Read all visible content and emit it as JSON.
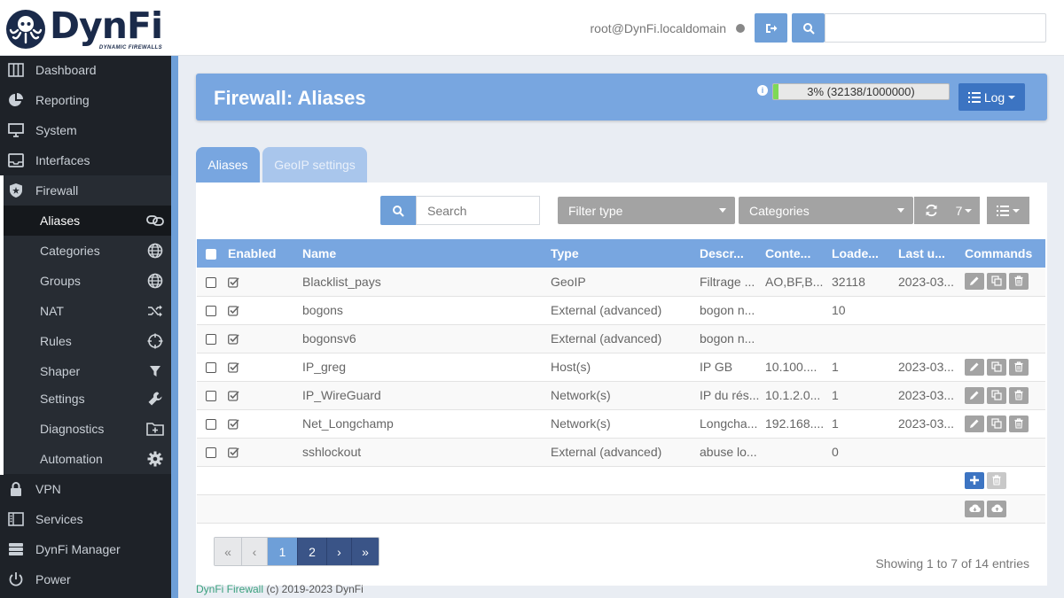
{
  "brand": {
    "name": "DynFi",
    "tagline": "DYNAMIC FIREWALLS"
  },
  "header": {
    "user": "root@DynFi.localdomain",
    "search_value": ""
  },
  "sidebar": {
    "items": [
      {
        "label": "Dashboard"
      },
      {
        "label": "Reporting"
      },
      {
        "label": "System"
      },
      {
        "label": "Interfaces"
      },
      {
        "label": "Firewall"
      },
      {
        "label": "VPN"
      },
      {
        "label": "Services"
      },
      {
        "label": "DynFi Manager"
      },
      {
        "label": "Power"
      }
    ],
    "firewall_sub": [
      {
        "label": "Aliases"
      },
      {
        "label": "Categories"
      },
      {
        "label": "Groups"
      },
      {
        "label": "NAT"
      },
      {
        "label": "Rules"
      },
      {
        "label": "Shaper"
      },
      {
        "label": "Settings"
      },
      {
        "label": "Diagnostics"
      },
      {
        "label": "Automation"
      }
    ]
  },
  "page": {
    "title": "Firewall: Aliases",
    "progress_text": "3% (32138/1000000)",
    "progress_fraction": 0.03,
    "log_label": "Log"
  },
  "tabs": [
    {
      "label": "Aliases"
    },
    {
      "label": "GeoIP settings"
    }
  ],
  "toolbar": {
    "search_placeholder": "Search",
    "filter_type": "Filter type",
    "categories": "Categories",
    "page_size": "7"
  },
  "table": {
    "headers": [
      "Enabled",
      "Name",
      "Type",
      "Descr...",
      "Conte...",
      "Loade...",
      "Last u...",
      "Commands"
    ],
    "rows": [
      {
        "name": "Blacklist_pays",
        "type": "GeoIP",
        "descr": "Filtrage ...",
        "content": "AO,BF,B...",
        "loaded": "32118",
        "last": "2023-03..."
      },
      {
        "name": "bogons",
        "type": "External (advanced)",
        "descr": "bogon n...",
        "content": "",
        "loaded": "10",
        "last": ""
      },
      {
        "name": "bogonsv6",
        "type": "External (advanced)",
        "descr": "bogon n...",
        "content": "",
        "loaded": "",
        "last": ""
      },
      {
        "name": "IP_greg",
        "type": "Host(s)",
        "descr": "IP GB",
        "content": "10.100....",
        "loaded": "1",
        "last": "2023-03..."
      },
      {
        "name": "IP_WireGuard",
        "type": "Network(s)",
        "descr": "IP du rés...",
        "content": "10.1.2.0...",
        "loaded": "1",
        "last": "2023-03..."
      },
      {
        "name": "Net_Longchamp",
        "type": "Network(s)",
        "descr": "Longcha...",
        "content": "192.168....",
        "loaded": "1",
        "last": "2023-03..."
      },
      {
        "name": "sshlockout",
        "type": "External (advanced)",
        "descr": "abuse lo...",
        "content": "",
        "loaded": "0",
        "last": ""
      }
    ]
  },
  "pagination": {
    "first": "«",
    "prev": "‹",
    "page1": "1",
    "page2": "2",
    "next": "›",
    "last": "»",
    "showing": "Showing 1 to 7 of 14 entries"
  },
  "footer": {
    "link": "DynFi Firewall",
    "text": "(c) 2019-2023 DynFi"
  },
  "colors": {
    "accent": "#78a6e0",
    "primary": "#3c74c2",
    "sidebar": "#1e2228",
    "progress": "#7ed957"
  }
}
